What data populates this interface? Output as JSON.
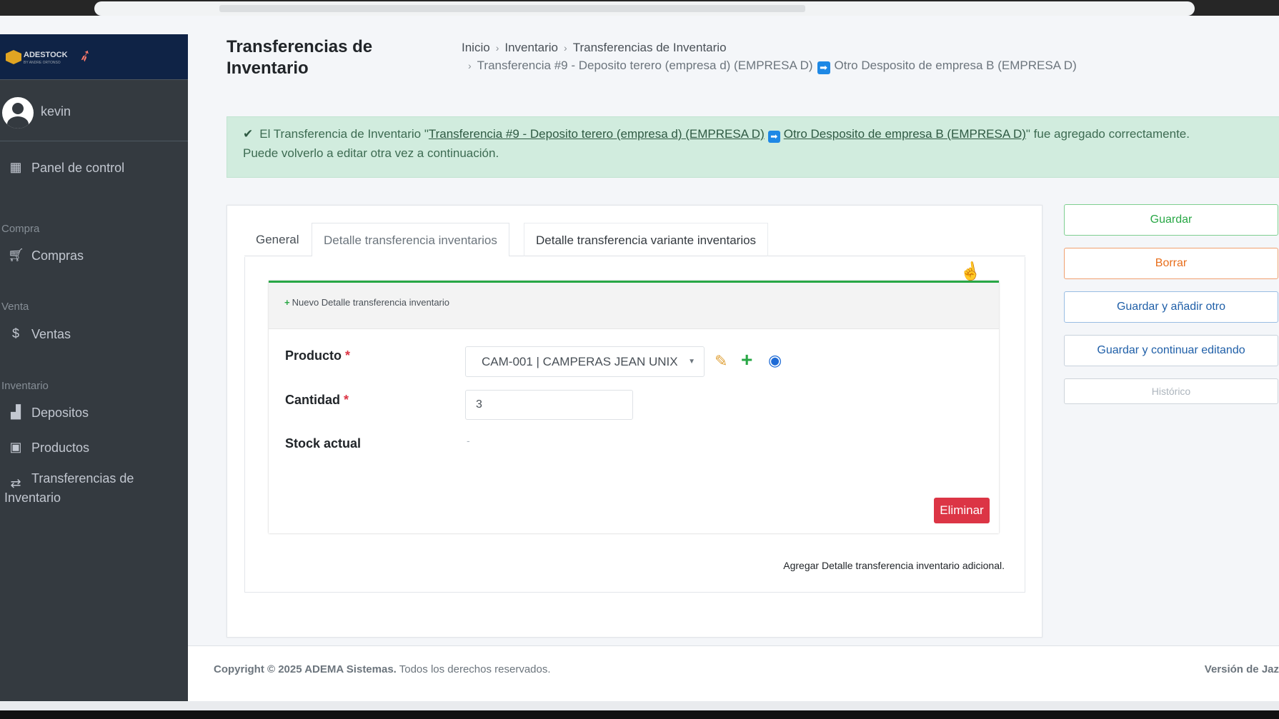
{
  "app": {
    "brand_name": "ADESTOCK",
    "brand_sub": "BY ANDRE ORTONSO"
  },
  "user": {
    "name": "kevin"
  },
  "sidebar": {
    "dashboard": "Panel de control",
    "sections": [
      {
        "header": "Compra",
        "items": [
          {
            "label": "Compras",
            "icon": "cart-icon"
          }
        ]
      },
      {
        "header": "Venta",
        "items": [
          {
            "label": "Ventas",
            "icon": "dollar-icon"
          }
        ]
      },
      {
        "header": "Inventario",
        "items": [
          {
            "label": "Depositos",
            "icon": "chart-icon"
          },
          {
            "label": "Productos",
            "icon": "box-icon"
          },
          {
            "label": "Transferencias de",
            "label2": "Inventario",
            "icon": "exchange-icon"
          }
        ]
      }
    ]
  },
  "page": {
    "title": "Transferencias de Inventario",
    "breadcrumb": [
      "Inicio",
      "Inventario",
      "Transferencias de Inventario"
    ],
    "breadcrumb_current_from": "Transferencia #9 - Deposito terero (empresa d) (EMPRESA D)",
    "breadcrumb_current_to": "Otro Desposito de empresa B (EMPRESA D)"
  },
  "alert": {
    "prefix": "El Transferencia de Inventario \"",
    "link_from": "Transferencia #9 - Deposito terero (empresa d) (EMPRESA D)",
    "link_to": "Otro Desposito de empresa B (EMPRESA D)",
    "suffix": "\" fue agregado correctamente.",
    "line2": "Puede volverlo a editar otra vez a continuación."
  },
  "tabs": [
    {
      "label": "General"
    },
    {
      "label": "Detalle transferencia inventarios"
    },
    {
      "label": "Detalle transferencia variante inventarios"
    }
  ],
  "inline": {
    "new_label": "Nuevo Detalle transferencia inventario",
    "product_label": "Producto",
    "product_value": "CAM-001 | CAMPERAS JEAN UNIX",
    "quantity_label": "Cantidad",
    "quantity_value": "3",
    "stock_label": "Stock actual",
    "stock_value": "-",
    "required_mark": "*",
    "delete_label": "Eliminar",
    "add_more_label": "Agregar Detalle transferencia inventario adicional."
  },
  "actions": {
    "save": "Guardar",
    "delete": "Borrar",
    "save_add": "Guardar y añadir otro",
    "save_continue": "Guardar y continuar editando",
    "history": "Histórico"
  },
  "footer": {
    "copyright": "Copyright © 2025 ADEMA Sistemas.",
    "rights": "Todos los derechos reservados.",
    "version": "Versión de Jaz"
  },
  "colors": {
    "sidebar_bg": "#343a40",
    "brand_bg": "#0f2346",
    "success": "#28a745",
    "danger": "#dc3545",
    "alert_bg": "#d1ecde"
  }
}
